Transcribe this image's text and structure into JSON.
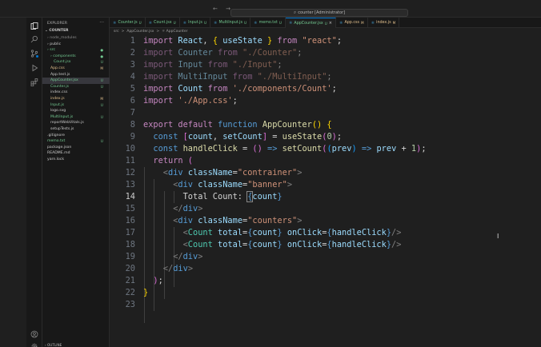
{
  "titlebar": {
    "nav": "← →",
    "search": "counter [Administrator]"
  },
  "sidebar": {
    "header": "EXPLORER",
    "root": "COUNTER",
    "items": [
      {
        "label": "node_modules",
        "indent": 0,
        "folder": true,
        "status": "",
        "color": "#8b8b8b"
      },
      {
        "label": "public",
        "indent": 0,
        "folder": true,
        "status": "",
        "color": "#cccccc"
      },
      {
        "label": "src",
        "indent": 0,
        "folder": true,
        "status": "●",
        "color": "#73c991"
      },
      {
        "label": "components",
        "indent": 1,
        "folder": true,
        "status": "●",
        "color": "#73c991"
      },
      {
        "label": "Count.jsx",
        "indent": 2,
        "folder": false,
        "status": "U",
        "color": "#73c991"
      },
      {
        "label": "App.css",
        "indent": 1,
        "folder": false,
        "status": "M",
        "color": "#e2c08d"
      },
      {
        "label": "App.test.js",
        "indent": 1,
        "folder": false,
        "status": "",
        "color": "#cccccc"
      },
      {
        "label": "AppCounter.jsx",
        "indent": 1,
        "folder": false,
        "status": "U",
        "color": "#73c991",
        "selected": true
      },
      {
        "label": "Counter.js",
        "indent": 1,
        "folder": false,
        "status": "U",
        "color": "#73c991"
      },
      {
        "label": "index.css",
        "indent": 1,
        "folder": false,
        "status": "",
        "color": "#cccccc"
      },
      {
        "label": "index.js",
        "indent": 1,
        "folder": false,
        "status": "M",
        "color": "#e2c08d"
      },
      {
        "label": "Input.js",
        "indent": 1,
        "folder": false,
        "status": "U",
        "color": "#73c991"
      },
      {
        "label": "logo.svg",
        "indent": 1,
        "folder": false,
        "status": "",
        "color": "#cccccc"
      },
      {
        "label": "MultiInput.js",
        "indent": 1,
        "folder": false,
        "status": "U",
        "color": "#73c991"
      },
      {
        "label": "reportWebVitals.js",
        "indent": 1,
        "folder": false,
        "status": "",
        "color": "#cccccc"
      },
      {
        "label": "setupTests.js",
        "indent": 1,
        "folder": false,
        "status": "",
        "color": "#cccccc"
      },
      {
        "label": ".gitignore",
        "indent": 0,
        "folder": false,
        "status": "",
        "color": "#cccccc"
      },
      {
        "label": "memo.txt",
        "indent": 0,
        "folder": false,
        "status": "U",
        "color": "#73c991"
      },
      {
        "label": "package.json",
        "indent": 0,
        "folder": false,
        "status": "",
        "color": "#cccccc"
      },
      {
        "label": "README.md",
        "indent": 0,
        "folder": false,
        "status": "",
        "color": "#cccccc"
      },
      {
        "label": "yarn.lock",
        "indent": 0,
        "folder": false,
        "status": "",
        "color": "#cccccc"
      }
    ],
    "outline": "OUTLINE"
  },
  "tabs": [
    {
      "label": "Counter.js",
      "status": "U",
      "color": "#73c991"
    },
    {
      "label": "Count.jsx",
      "status": "U",
      "color": "#73c991"
    },
    {
      "label": "Input.js",
      "status": "U",
      "color": "#73c991"
    },
    {
      "label": "MultiInput.js",
      "status": "U",
      "color": "#73c991"
    },
    {
      "label": "memo.txt",
      "status": "U",
      "color": "#73c991"
    },
    {
      "label": "AppCounter.jsx",
      "status": "U",
      "color": "#73c991",
      "active": true
    },
    {
      "label": "App.css",
      "status": "M",
      "color": "#e2c08d"
    },
    {
      "label": "index.js",
      "status": "M",
      "color": "#e2c08d"
    }
  ],
  "breadcrumb": [
    "src",
    ">",
    "AppCounter.jsx",
    ">",
    "⚛ AppCounter"
  ],
  "editor": {
    "current_line": 14,
    "lines": [
      [
        [
          "k",
          "import "
        ],
        [
          "v",
          "React"
        ],
        [
          "p",
          ", "
        ],
        [
          "y",
          "{ "
        ],
        [
          "v",
          "useState"
        ],
        [
          "y",
          " }"
        ],
        [
          "k",
          " from "
        ],
        [
          "s",
          "\"react\""
        ],
        [
          "p",
          ";"
        ]
      ],
      [
        [
          "k dim",
          "import "
        ],
        [
          "v dim",
          "Counter"
        ],
        [
          "k dim",
          " from "
        ],
        [
          "s dim",
          "\"./Counter\""
        ],
        [
          "p dim",
          ";"
        ]
      ],
      [
        [
          "k dim",
          "import "
        ],
        [
          "v dim",
          "Input"
        ],
        [
          "k dim",
          " from "
        ],
        [
          "s dim",
          "\"./Input\""
        ],
        [
          "p dim",
          ";"
        ]
      ],
      [
        [
          "k dim",
          "import "
        ],
        [
          "v dim",
          "MultiInput"
        ],
        [
          "k dim",
          " from "
        ],
        [
          "s dim",
          "\"./MultiInput\""
        ],
        [
          "p dim",
          ";"
        ]
      ],
      [
        [
          "k",
          "import "
        ],
        [
          "v",
          "Count"
        ],
        [
          "k",
          " from "
        ],
        [
          "s",
          "'./components/Count'"
        ],
        [
          "p",
          ";"
        ]
      ],
      [
        [
          "k",
          "import "
        ],
        [
          "s",
          "'./App.css'"
        ],
        [
          "p",
          ";"
        ]
      ],
      [],
      [
        [
          "k",
          "export "
        ],
        [
          "k",
          "default "
        ],
        [
          "k2",
          "function "
        ],
        [
          "f",
          "AppCounter"
        ],
        [
          "y",
          "() {"
        ]
      ],
      [
        [
          "k2",
          "  const "
        ],
        [
          "pk",
          "["
        ],
        [
          "v",
          "count"
        ],
        [
          "p",
          ", "
        ],
        [
          "v",
          "setCount"
        ],
        [
          "pk",
          "]"
        ],
        [
          "p",
          " = "
        ],
        [
          "f",
          "useState"
        ],
        [
          "pk",
          "("
        ],
        [
          "n",
          "0"
        ],
        [
          "pk",
          ")"
        ],
        [
          "p",
          ";"
        ]
      ],
      [
        [
          "k2",
          "  const "
        ],
        [
          "f",
          "handleClick"
        ],
        [
          "p",
          " = "
        ],
        [
          "pk",
          "()"
        ],
        [
          "k2",
          " => "
        ],
        [
          "f",
          "setCount"
        ],
        [
          "pk",
          "("
        ],
        [
          "b",
          "("
        ],
        [
          "v",
          "prev"
        ],
        [
          "b",
          ")"
        ],
        [
          "k2",
          " => "
        ],
        [
          "v",
          "prev"
        ],
        [
          "p",
          " + "
        ],
        [
          "n",
          "1"
        ],
        [
          "pk",
          ")"
        ],
        [
          "p",
          ";"
        ]
      ],
      [
        [
          "k",
          "  return "
        ],
        [
          "pk",
          "("
        ]
      ],
      [
        [
          "t",
          "    <"
        ],
        [
          "k2",
          "div "
        ],
        [
          "v",
          "className"
        ],
        [
          "p",
          "="
        ],
        [
          "s",
          "\"contrainer\""
        ],
        [
          "t",
          ">"
        ]
      ],
      [
        [
          "t",
          "      <"
        ],
        [
          "k2",
          "div "
        ],
        [
          "v",
          "className"
        ],
        [
          "p",
          "="
        ],
        [
          "s",
          "\"banner\""
        ],
        [
          "t",
          ">"
        ]
      ],
      [
        [
          "p",
          "        Total Count: "
        ],
        [
          "k2 cb",
          "{"
        ],
        [
          "v",
          "count"
        ],
        [
          "k2",
          "}"
        ]
      ],
      [
        [
          "t",
          "      </"
        ],
        [
          "k2",
          "div"
        ],
        [
          "t",
          ">"
        ]
      ],
      [
        [
          "t",
          "      <"
        ],
        [
          "k2",
          "div "
        ],
        [
          "v",
          "className"
        ],
        [
          "p",
          "="
        ],
        [
          "s",
          "\"counters\""
        ],
        [
          "t",
          ">"
        ]
      ],
      [
        [
          "t",
          "        <"
        ],
        [
          "c",
          "Count "
        ],
        [
          "v",
          "total"
        ],
        [
          "p",
          "="
        ],
        [
          "k2",
          "{"
        ],
        [
          "v",
          "count"
        ],
        [
          "k2",
          "} "
        ],
        [
          "v",
          "onClick"
        ],
        [
          "p",
          "="
        ],
        [
          "k2",
          "{"
        ],
        [
          "v",
          "handleClick"
        ],
        [
          "k2",
          "}"
        ],
        [
          "t",
          "/>"
        ]
      ],
      [
        [
          "t",
          "        <"
        ],
        [
          "c",
          "Count "
        ],
        [
          "v",
          "total"
        ],
        [
          "p",
          "="
        ],
        [
          "k2",
          "{"
        ],
        [
          "v",
          "count"
        ],
        [
          "k2",
          "} "
        ],
        [
          "v",
          "onClick"
        ],
        [
          "p",
          "="
        ],
        [
          "k2",
          "{"
        ],
        [
          "v",
          "handleClick"
        ],
        [
          "k2",
          "}"
        ],
        [
          "t",
          "/>"
        ]
      ],
      [
        [
          "t",
          "      </"
        ],
        [
          "k2",
          "div"
        ],
        [
          "t",
          ">"
        ]
      ],
      [
        [
          "t",
          "    </"
        ],
        [
          "k2",
          "div"
        ],
        [
          "t",
          ">"
        ]
      ],
      [
        [
          "pk",
          "  )"
        ],
        [
          "p",
          ";"
        ]
      ],
      [
        [
          "y",
          "}"
        ]
      ],
      []
    ]
  },
  "colors": {
    "accent": "#0078d4",
    "untracked": "#73c991",
    "modified": "#e2c08d"
  }
}
